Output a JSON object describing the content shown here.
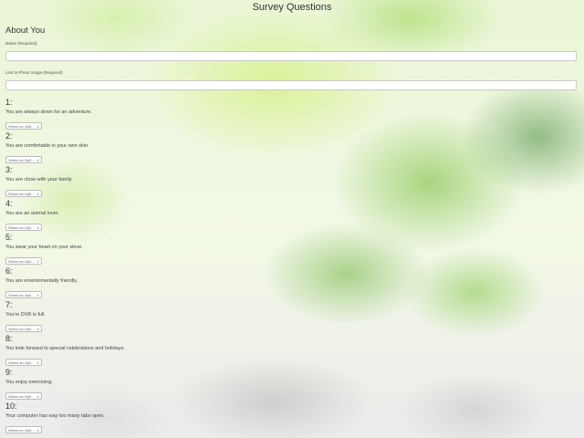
{
  "page": {
    "title": "Survey Questions"
  },
  "about": {
    "heading": "About You",
    "name_label": "Name (Required)",
    "name_value": "",
    "photo_label": "Link to Photo Image (Required)",
    "photo_value": ""
  },
  "select_placeholder": "Select an Opti...",
  "questions": [
    {
      "number": "1:",
      "text": "You are always down for an adventure."
    },
    {
      "number": "2:",
      "text": "You are comfortable in your own skin."
    },
    {
      "number": "3:",
      "text": "You are close with your family."
    },
    {
      "number": "4:",
      "text": "You are an animal lover."
    },
    {
      "number": "5:",
      "text": "You wear your heart on your sleve."
    },
    {
      "number": "6:",
      "text": "You are environmentally friendly."
    },
    {
      "number": "7:",
      "text": "You're DVR is full."
    },
    {
      "number": "8:",
      "text": "You look forward to special celebrations and holidays."
    },
    {
      "number": "9:",
      "text": "You enjoy exercising."
    },
    {
      "number": "10:",
      "text": "Your computer has way too many tabs open."
    }
  ],
  "icons": {
    "select_arrow": "chevron-down-icon"
  },
  "colors": {
    "text": "#333333",
    "background_green": "#a8d86a"
  }
}
